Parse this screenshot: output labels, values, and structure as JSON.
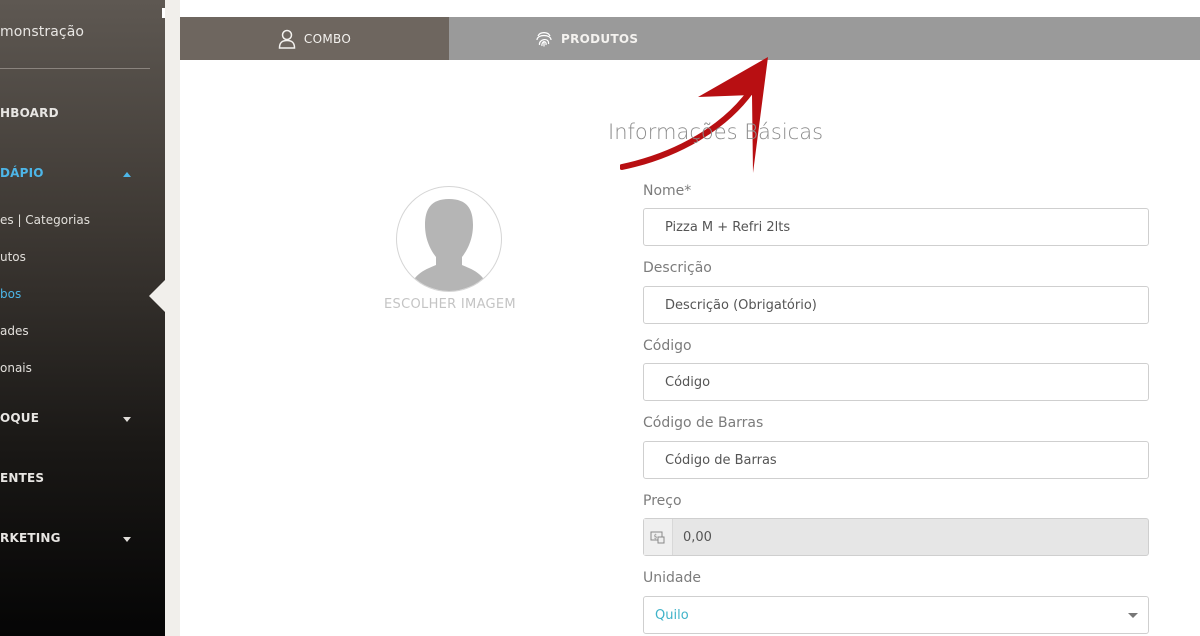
{
  "sidebar": {
    "user_name": "monstração",
    "items": [
      {
        "label": "HBOARD"
      },
      {
        "label": "DÁPIO"
      },
      {
        "label": "OQUE"
      },
      {
        "label": "ENTES"
      },
      {
        "label": "RKETING"
      }
    ],
    "subitems": [
      {
        "label": "es | Categorias"
      },
      {
        "label": "utos"
      },
      {
        "label": "bos"
      },
      {
        "label": "ades"
      },
      {
        "label": "onais"
      }
    ],
    "active_color": "#4db6e8"
  },
  "tabs": [
    {
      "label": "COMBO",
      "icon": "user-icon"
    },
    {
      "label": "PRODUTOS",
      "icon": "fingerprint-icon"
    }
  ],
  "form": {
    "section_title": "Informações Básicas",
    "image_label": "ESCOLHER IMAGEM",
    "nome": {
      "label": "Nome*",
      "value": "Pizza M + Refri 2lts"
    },
    "descricao": {
      "label": "Descrição",
      "placeholder": "Descrição (Obrigatório)"
    },
    "codigo": {
      "label": "Código",
      "placeholder": "Código"
    },
    "codigo_barras": {
      "label": "Código de Barras",
      "placeholder": "Código de Barras"
    },
    "preco": {
      "label": "Preço",
      "value": "0,00"
    },
    "unidade": {
      "label": "Unidade",
      "value": "Quilo"
    }
  }
}
